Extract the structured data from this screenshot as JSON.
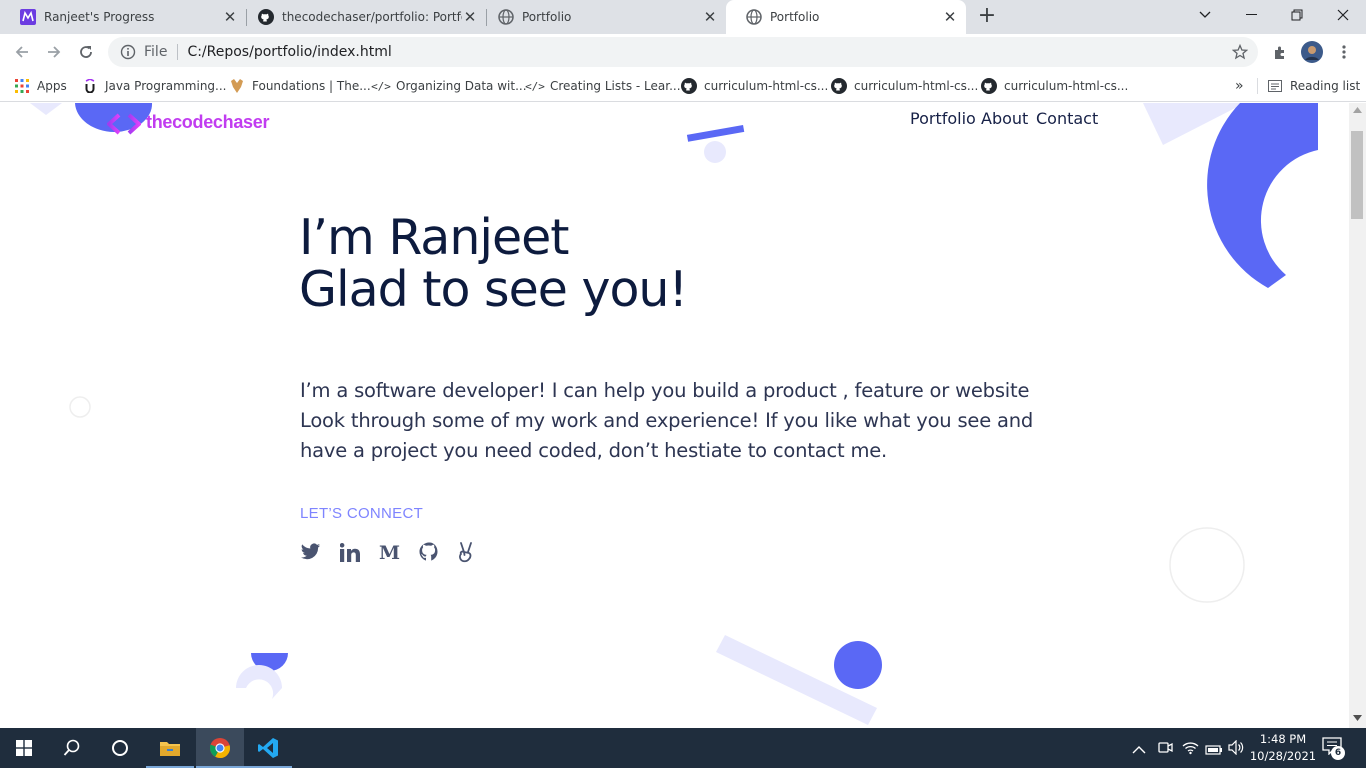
{
  "browser": {
    "tabs": [
      {
        "title": "Ranjeet's Progress",
        "icon": "progress-logo-icon"
      },
      {
        "title": "thecodechaser/portfolio: Portfolio",
        "icon": "github-icon"
      },
      {
        "title": "Portfolio",
        "icon": "globe-icon"
      },
      {
        "title": "Portfolio",
        "icon": "globe-icon"
      }
    ],
    "address": {
      "scheme_label": "File",
      "url": "C:/Repos/portfolio/index.html"
    },
    "bookmarks": [
      {
        "label": "Apps"
      },
      {
        "label": "Java Programming..."
      },
      {
        "label": "Foundations | The..."
      },
      {
        "label": "Organizing Data wit..."
      },
      {
        "label": "Creating Lists - Lear..."
      },
      {
        "label": "curriculum-html-cs..."
      },
      {
        "label": "curriculum-html-cs..."
      },
      {
        "label": "curriculum-html-cs..."
      }
    ],
    "reading_list": "Reading list",
    "more_bookmarks": "»"
  },
  "site": {
    "logo_text": "thecodechaser",
    "nav": [
      "Portfolio",
      "About",
      "Contact"
    ],
    "hero": {
      "line1": "I’m Ranjeet",
      "line2": "Glad to see you!"
    },
    "bio": [
      "I’m a software developer! I can help you build a product , feature or website",
      "Look through some of my work and experience! If you like what you see and",
      "have a project you need coded, don’t hestiate to contact me."
    ],
    "connect_label": "LET’S CONNECT",
    "socials": [
      "twitter-icon",
      "linkedin-icon",
      "medium-icon",
      "github-icon",
      "angellist-icon"
    ],
    "colors": {
      "accent": "#5a68f5",
      "heading": "#0d1b3e",
      "text": "#2d3552",
      "light": "#e8e9fd"
    }
  },
  "taskbar": {
    "time": "1:48 PM",
    "date": "10/28/2021",
    "notifications": "6"
  }
}
